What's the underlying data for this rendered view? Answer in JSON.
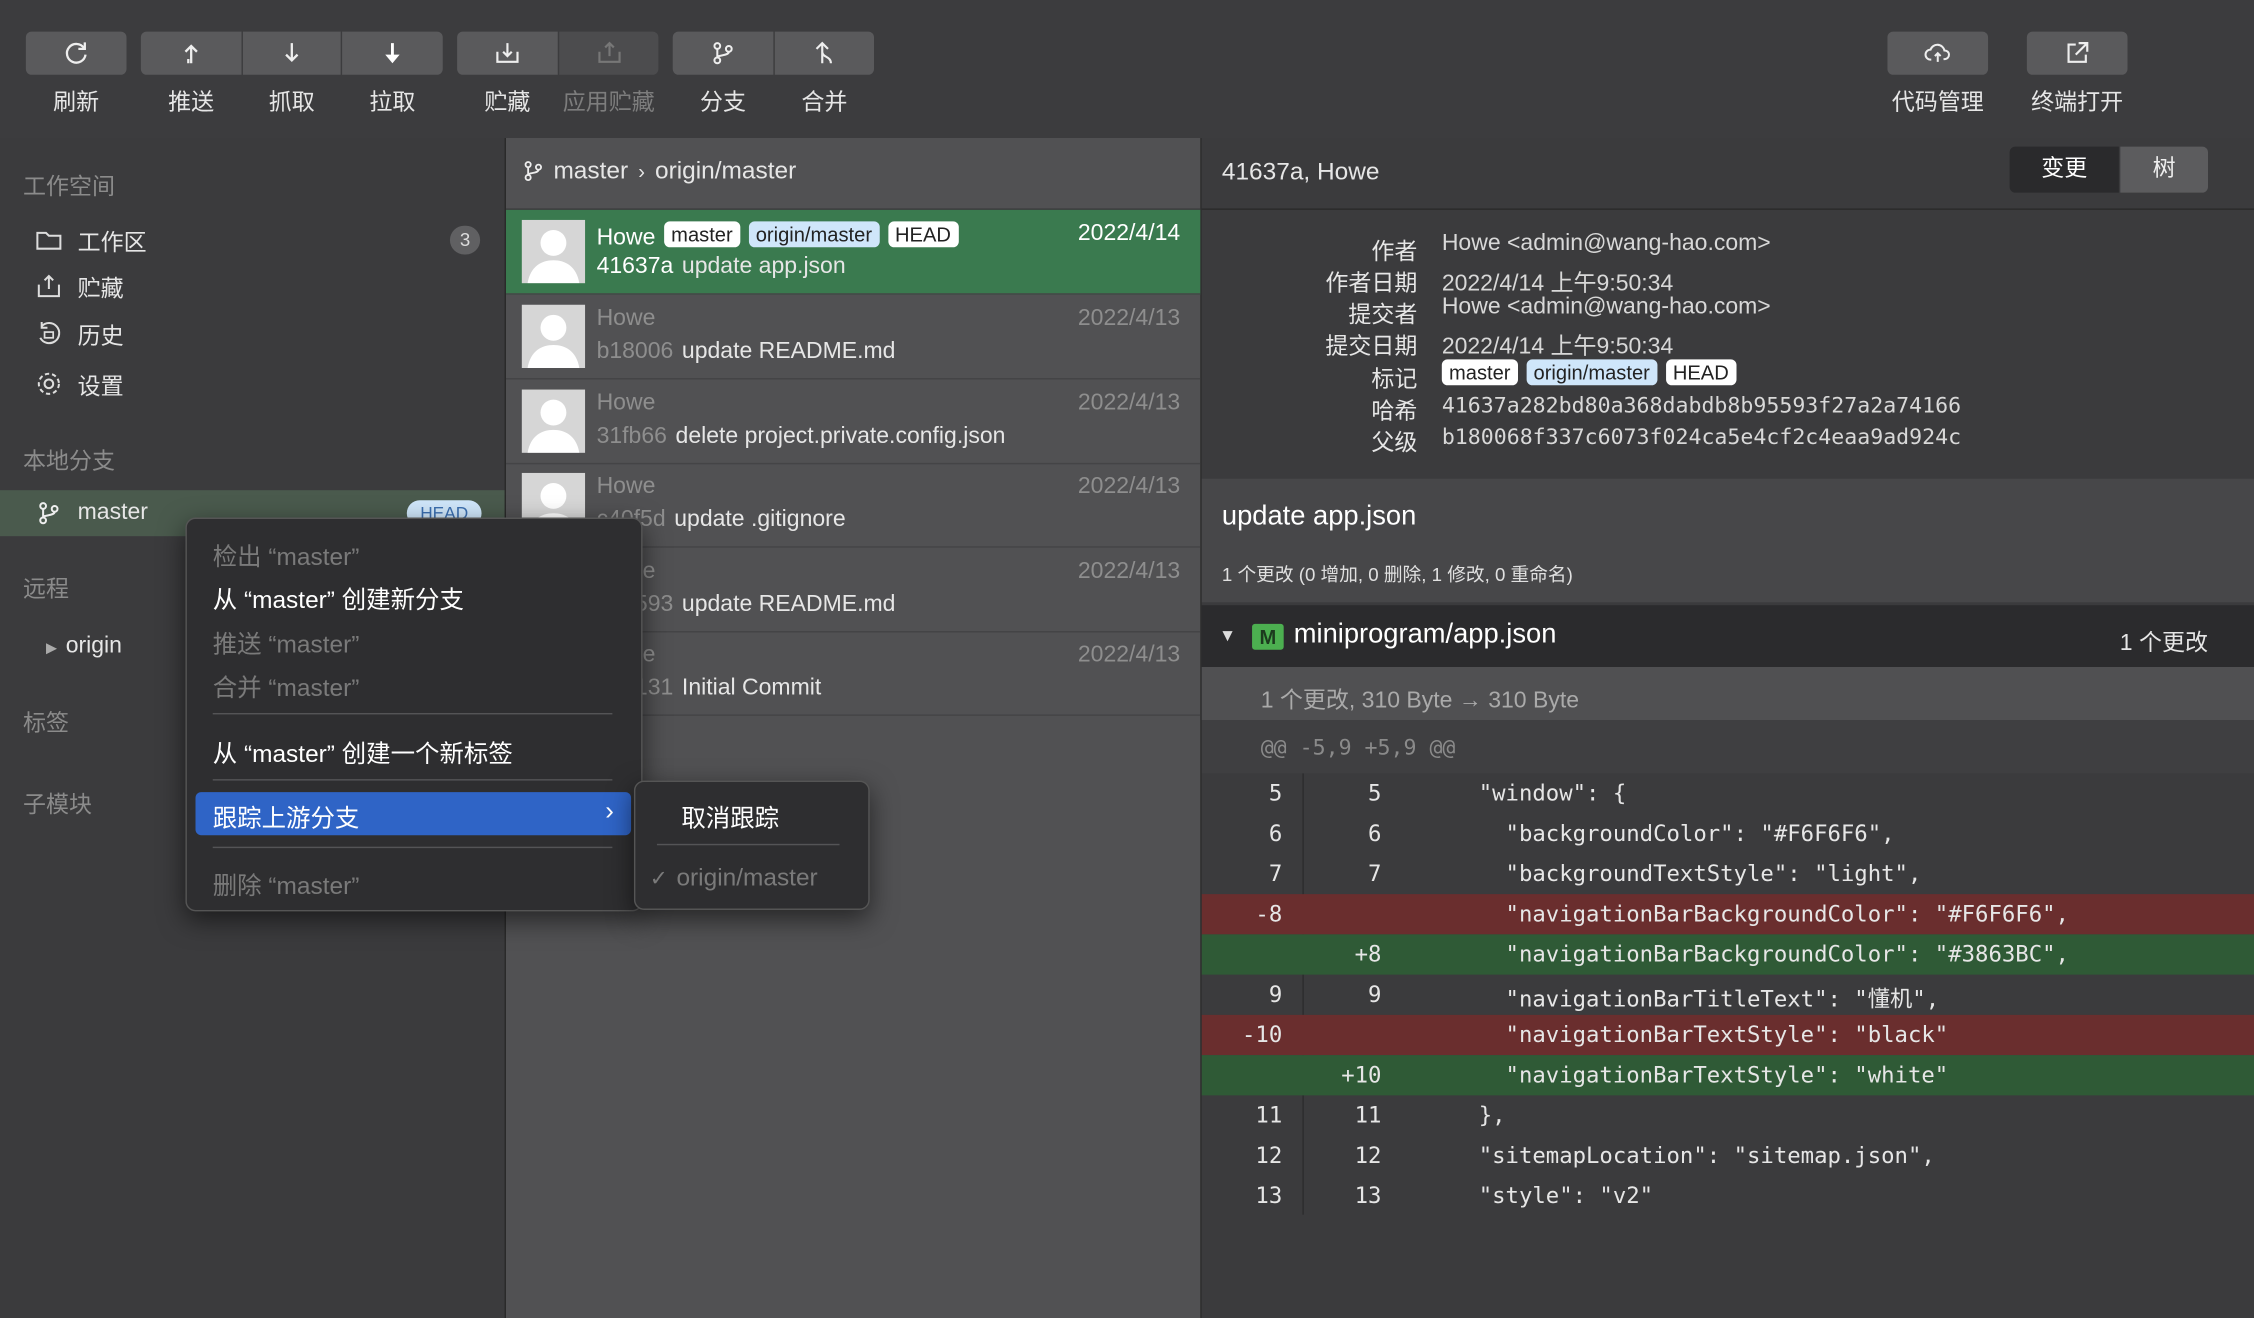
{
  "toolbar": {
    "refresh": "刷新",
    "push": "推送",
    "fetch": "抓取",
    "pull": "拉取",
    "stash": "贮藏",
    "apply_stash": "应用贮藏",
    "branch": "分支",
    "merge": "合并",
    "code_manage": "代码管理",
    "terminal": "终端打开"
  },
  "sidebar": {
    "workspace_header": "工作空间",
    "items": [
      {
        "label": "工作区",
        "badge": "3",
        "icon": "folder-icon"
      },
      {
        "label": "贮藏",
        "icon": "stash-icon"
      },
      {
        "label": "历史",
        "icon": "history-icon"
      },
      {
        "label": "设置",
        "icon": "gear-icon"
      }
    ],
    "local_branches_header": "本地分支",
    "branch": {
      "name": "master",
      "badge": "HEAD"
    },
    "remote_header": "远程",
    "remote": "origin",
    "tags_header": "标签",
    "submodules_header": "子模块"
  },
  "commits_header": {
    "branch": "master",
    "upstream": "origin/master"
  },
  "commits": [
    {
      "author": "Howe",
      "hash": "41637a",
      "message": "update app.json",
      "date": "2022/4/14",
      "tags": [
        "master",
        "origin/master",
        "HEAD"
      ]
    },
    {
      "author": "Howe",
      "hash": "b18006",
      "message": "update README.md",
      "date": "2022/4/13"
    },
    {
      "author": "Howe",
      "hash": "31fb66",
      "message": "delete project.private.config.json",
      "date": "2022/4/13"
    },
    {
      "author": "Howe",
      "hash": "c40f5d",
      "message": "update .gitignore",
      "date": "2022/4/13"
    },
    {
      "author": "Howe",
      "hash": "5a5593",
      "message": "update README.md",
      "date": "2022/4/13"
    },
    {
      "author": "Howe",
      "hash": "8a9131",
      "message": "Initial Commit",
      "date": "2022/4/13"
    }
  ],
  "detail": {
    "header": "41637a, Howe",
    "tabs": {
      "changes": "变更",
      "tree": "树"
    },
    "meta": {
      "author_label": "作者",
      "author": "Howe <admin@wang-hao.com>",
      "author_date_label": "作者日期",
      "author_date": "2022/4/14 上午9:50:34",
      "committer_label": "提交者",
      "committer": "Howe <admin@wang-hao.com>",
      "commit_date_label": "提交日期",
      "commit_date": "2022/4/14 上午9:50:34",
      "tags_label": "标记",
      "tags": [
        "master",
        "origin/master",
        "HEAD"
      ],
      "hash_label": "哈希",
      "hash": "41637a282bd80a368dabdb8b95593f27a2a74166",
      "parent_label": "父级",
      "parent": "b180068f337c6073f024ca5e4cf2c4eaa9ad924c"
    },
    "subject": "update app.json",
    "summary": "1 个更改 (0 增加, 0 删除, 1 修改, 0 重命名)",
    "file": {
      "status": "M",
      "path": "miniprogram/app.json",
      "changes": "1 个更改"
    },
    "file_summary": "1 个更改, 310 Byte → 310 Byte",
    "hunk": "@@ -5,9 +5,9 @@",
    "diff": [
      {
        "old": "5",
        "new": "5",
        "text": "  \"window\": {",
        "type": "ctx"
      },
      {
        "old": "6",
        "new": "6",
        "text": "    \"backgroundColor\": \"#F6F6F6\",",
        "type": "ctx"
      },
      {
        "old": "7",
        "new": "7",
        "text": "    \"backgroundTextStyle\": \"light\",",
        "type": "ctx"
      },
      {
        "old": "-8",
        "new": "",
        "text": "    \"navigationBarBackgroundColor\": \"#F6F6F6\",",
        "type": "del"
      },
      {
        "old": "",
        "new": "+8",
        "text": "    \"navigationBarBackgroundColor\": \"#3863BC\",",
        "type": "add"
      },
      {
        "old": "9",
        "new": "9",
        "text": "    \"navigationBarTitleText\": \"懂机\",",
        "type": "ctx"
      },
      {
        "old": "-10",
        "new": "",
        "text": "    \"navigationBarTextStyle\": \"black\"",
        "type": "del"
      },
      {
        "old": "",
        "new": "+10",
        "text": "    \"navigationBarTextStyle\": \"white\"",
        "type": "add"
      },
      {
        "old": "11",
        "new": "11",
        "text": "  },",
        "type": "ctx"
      },
      {
        "old": "12",
        "new": "12",
        "text": "  \"sitemapLocation\": \"sitemap.json\",",
        "type": "ctx"
      },
      {
        "old": "13",
        "new": "13",
        "text": "  \"style\": \"v2\"",
        "type": "ctx"
      }
    ]
  },
  "context_menu": {
    "checkout": "检出 “master”",
    "new_branch": "从 “master” 创建新分支",
    "push": "推送 “master”",
    "merge": "合并 “master”",
    "new_tag": "从 “master” 创建一个新标签",
    "track_upstream": "跟踪上游分支",
    "delete": "删除 “master”"
  },
  "submenu": {
    "untrack": "取消跟踪",
    "origin_master": "origin/master"
  },
  "colors": {
    "selection_green": "#3a7a4f",
    "menu_highlight": "#2f64c6",
    "diff_del": "#6a2e2e",
    "diff_add": "#2f5a36"
  }
}
